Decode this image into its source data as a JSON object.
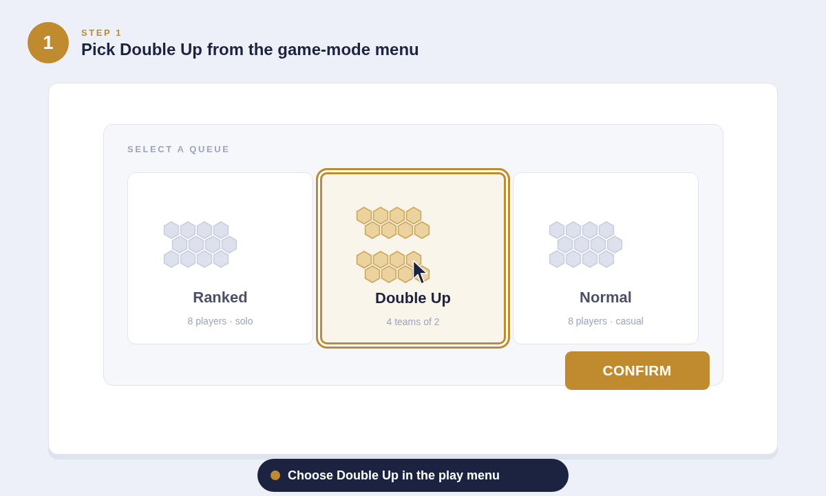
{
  "step": {
    "number": "1",
    "label": "STEP 1",
    "title": "Pick Double Up from the game-mode menu"
  },
  "queue_panel": {
    "heading": "SELECT A QUEUE",
    "options": [
      {
        "kind": "single",
        "name": "Ranked",
        "detail": "8 players · solo",
        "selected": false,
        "hovered": false
      },
      {
        "kind": "double",
        "name": "Double Up",
        "detail": "4 teams of 2",
        "selected": true,
        "hovered": true
      },
      {
        "kind": "single",
        "name": "Normal",
        "detail": "8 players · casual",
        "selected": false,
        "hovered": false
      }
    ],
    "confirm_button": "CONFIRM"
  },
  "hint": "Choose Double Up in the play menu"
}
